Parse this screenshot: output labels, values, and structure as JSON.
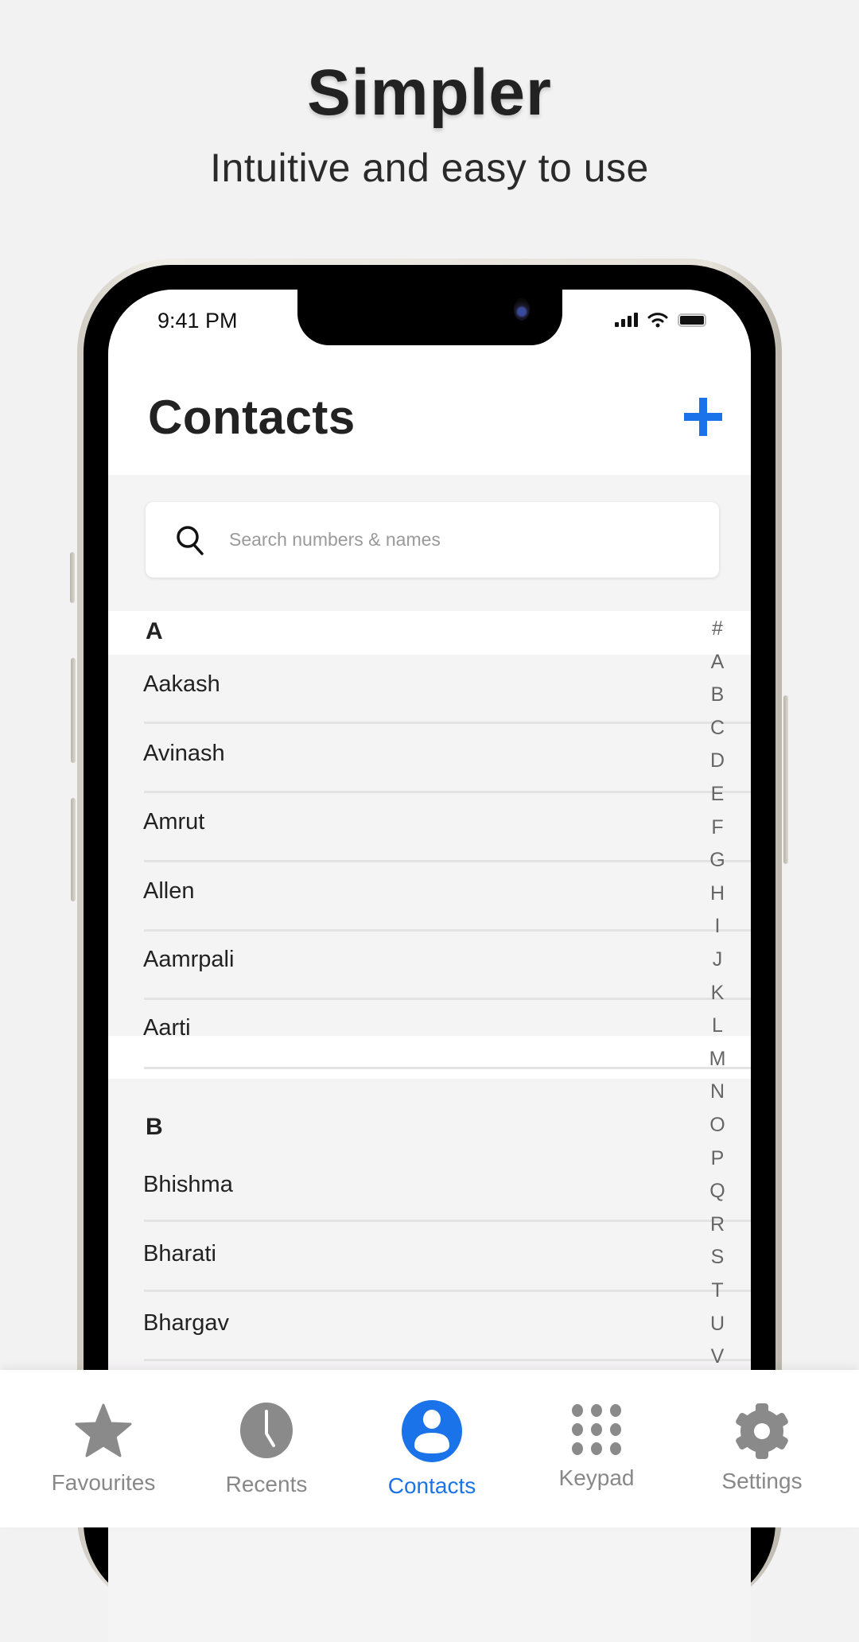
{
  "promo": {
    "headline": "Simpler",
    "subline": "Intuitive and easy to use"
  },
  "status_bar": {
    "time": "9:41 PM",
    "icons": [
      "cellular-signal-icon",
      "wifi-icon",
      "battery-icon"
    ]
  },
  "header": {
    "title": "Contacts",
    "add_icon": "plus-icon"
  },
  "search": {
    "placeholder": "Search numbers & names",
    "icon": "search-icon"
  },
  "sections": [
    {
      "letter": "A",
      "contacts": [
        "Aakash",
        "Avinash",
        "Amrut",
        "Allen",
        "Aamrpali",
        "Aarti"
      ]
    },
    {
      "letter": "B",
      "contacts": [
        "Bhishma",
        "Bharati",
        "Bhargav"
      ]
    }
  ],
  "index_letters": [
    "#",
    "A",
    "B",
    "C",
    "D",
    "E",
    "F",
    "G",
    "H",
    "I",
    "J",
    "K",
    "L",
    "M",
    "N",
    "O",
    "P",
    "Q",
    "R",
    "S",
    "T",
    "U",
    "V"
  ],
  "bottom_nav": {
    "active_color": "#1a73e8",
    "inactive_color": "#888888",
    "items": [
      {
        "label": "Favourites",
        "icon": "star-icon",
        "active": false
      },
      {
        "label": "Recents",
        "icon": "clock-icon",
        "active": false
      },
      {
        "label": "Contacts",
        "icon": "person-icon",
        "active": true
      },
      {
        "label": "Keypad",
        "icon": "keypad-icon",
        "active": false
      },
      {
        "label": "Settings",
        "icon": "gear-icon",
        "active": false
      }
    ]
  }
}
